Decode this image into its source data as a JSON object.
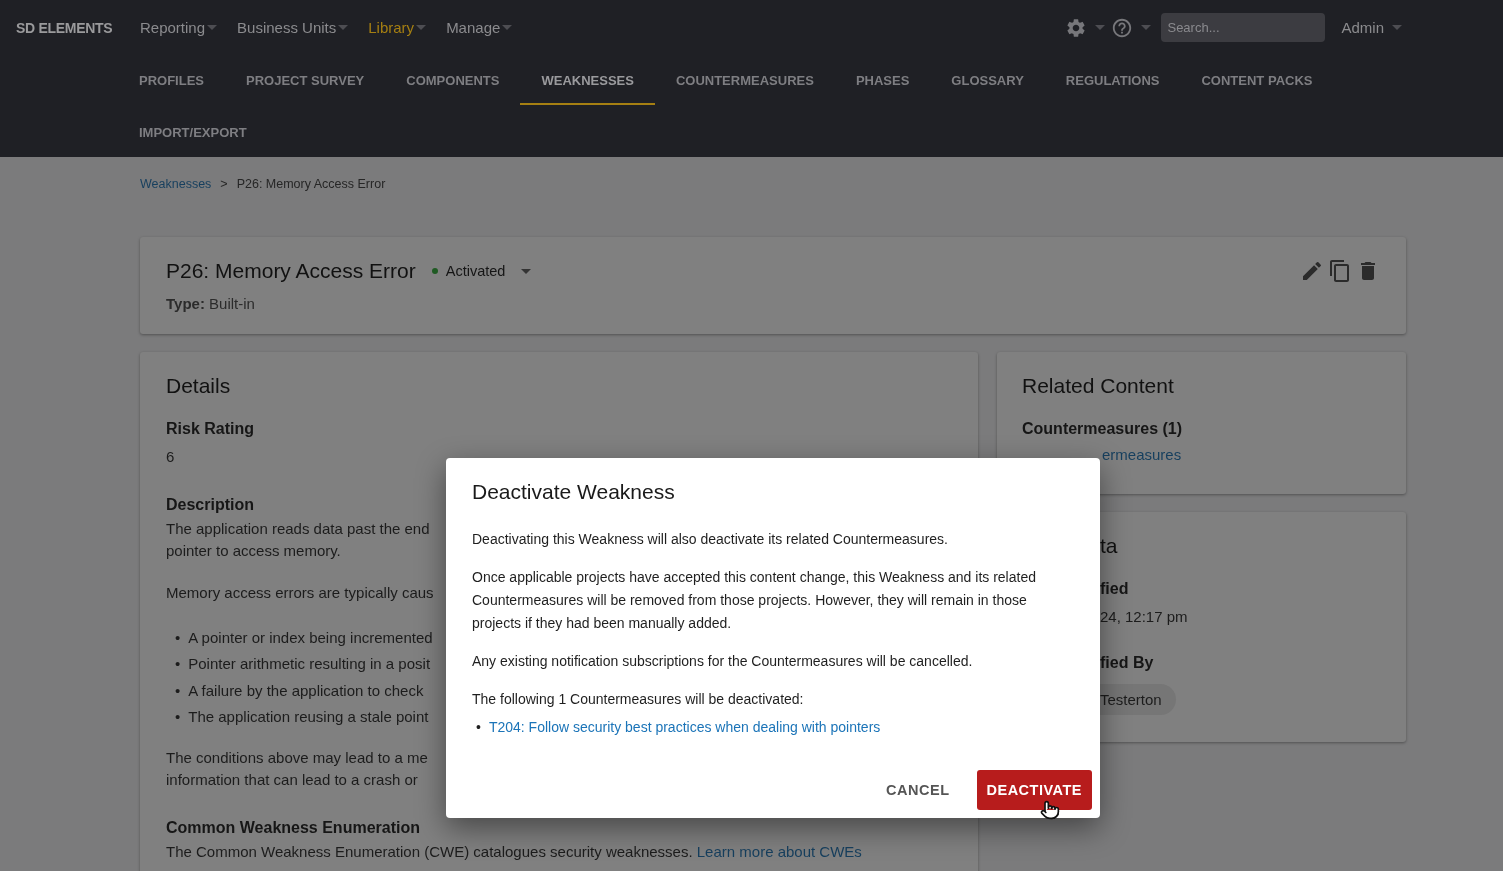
{
  "header": {
    "logo": "SD ELEMENTS",
    "menus": [
      {
        "label": "Reporting",
        "selected": false
      },
      {
        "label": "Business Units",
        "selected": false
      },
      {
        "label": "Library",
        "selected": true
      },
      {
        "label": "Manage",
        "selected": false
      }
    ],
    "search": {
      "placeholder": "Search..."
    },
    "user": "Admin"
  },
  "tabs": [
    {
      "label": "PROFILES",
      "selected": false
    },
    {
      "label": "PROJECT SURVEY",
      "selected": false
    },
    {
      "label": "COMPONENTS",
      "selected": false
    },
    {
      "label": "WEAKNESSES",
      "selected": true
    },
    {
      "label": "COUNTERMEASURES",
      "selected": false
    },
    {
      "label": "PHASES",
      "selected": false
    },
    {
      "label": "GLOSSARY",
      "selected": false
    },
    {
      "label": "REGULATIONS",
      "selected": false
    },
    {
      "label": "CONTENT PACKS",
      "selected": false
    },
    {
      "label": "IMPORT/EXPORT",
      "selected": false
    }
  ],
  "breadcrumb": [
    {
      "label": "Weaknesses",
      "kind": "link"
    },
    {
      "label": ">",
      "kind": "separator"
    },
    {
      "label": "P26: Memory Access Error",
      "kind": "current"
    }
  ],
  "title_card": {
    "title": "P26: Memory Access Error",
    "status": "Activated",
    "type_label": "Type:",
    "type_value": "Built-in"
  },
  "details": {
    "title": "Details",
    "risk_label": "Risk Rating",
    "risk_value": "6",
    "description_label": "Description",
    "blocks": [
      {
        "kind": "paragraph",
        "lines": [
          "The application reads data past the end",
          "pointer to access memory."
        ]
      },
      {
        "kind": "paragraph",
        "lines": [
          "Memory access errors are typically caus"
        ]
      },
      {
        "kind": "bullets",
        "lines": [
          {
            "marker": "•",
            "text": "A pointer or index being incremented"
          },
          {
            "marker": "•",
            "text": "Pointer arithmetic resulting in a posit"
          },
          {
            "marker": "•",
            "text": "A failure by the application to check"
          },
          {
            "marker": "•",
            "text": "The application reusing a stale point"
          }
        ]
      },
      {
        "kind": "paragraph",
        "lines": [
          "The conditions above may lead to a me",
          "information that can lead to a crash or"
        ]
      }
    ],
    "cwe_label": "Common Weakness Enumeration",
    "cwe_text": "The Common Weakness Enumeration (CWE) catalogues security weaknesses.",
    "cwe_link": "Learn more about CWEs"
  },
  "related": {
    "title": "Related Content",
    "countermeasures_label": "Countermeasures (1)",
    "countermeasures_link": "ermeasures"
  },
  "metadata": {
    "title": "ta",
    "modified_label": "fied",
    "modified_value": "24, 12:17 pm",
    "modified_by_label": "fied By",
    "modified_by": "Testerton"
  },
  "dialog": {
    "title": "Deactivate Weakness",
    "paragraphs": [
      "Deactivating this Weakness will also deactivate its related Countermeasures.",
      "Once applicable projects have accepted this content change, this Weakness and its related Countermeasures will be removed from those projects. However, they will remain in those projects if they had been manually added.",
      "Any existing notification subscriptions for the Countermeasures will be cancelled.",
      "The following 1 Countermeasures will be deactivated:"
    ],
    "items": [
      {
        "marker": "•",
        "text": "T204: Follow security best practices when dealing with pointers"
      }
    ],
    "cancel": "CANCEL",
    "confirm": "DEACTIVATE"
  }
}
